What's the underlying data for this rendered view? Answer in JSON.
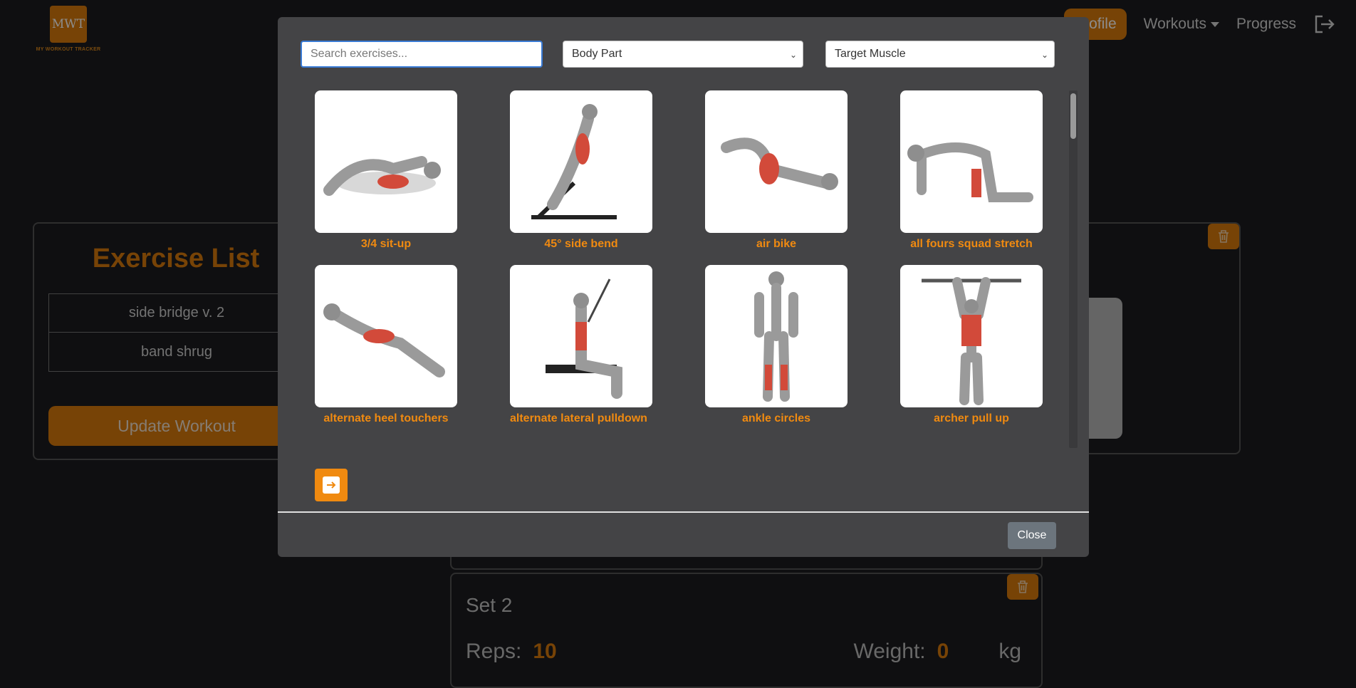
{
  "logo": {
    "text": "MWT",
    "subtitle": "MY WORKOUT TRACKER"
  },
  "nav": {
    "profile": "Profile",
    "workouts": "Workouts",
    "progress": "Progress"
  },
  "exercise_list": {
    "title": "Exercise List",
    "items": [
      "side bridge v. 2",
      "band shrug"
    ],
    "update_button": "Update Workout"
  },
  "set": {
    "title": "Set 2",
    "reps_label": "Reps:",
    "reps_value": "10",
    "weight_label": "Weight:",
    "weight_value": "0",
    "unit": "kg"
  },
  "modal": {
    "search_placeholder": "Search exercises...",
    "body_part": "Body Part",
    "target_muscle": "Target Muscle",
    "close": "Close",
    "exercises": [
      "3/4 sit-up",
      "45° side bend",
      "air bike",
      "all fours squad stretch",
      "alternate heel touchers",
      "alternate lateral pulldown",
      "ankle circles",
      "archer pull up"
    ]
  },
  "colors": {
    "accent": "#d97a0c",
    "label": "#f08a10",
    "background": "#1c1c1f",
    "modal": "#444446"
  }
}
